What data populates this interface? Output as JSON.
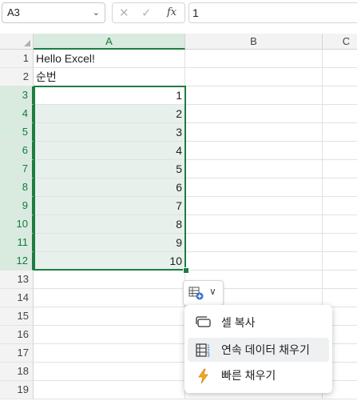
{
  "formula_bar": {
    "name_box": "A3",
    "cancel_glyph": "✕",
    "confirm_glyph": "✓",
    "fx_label": "fx",
    "formula_value": "1"
  },
  "columns": [
    "A",
    "B",
    "C"
  ],
  "selected_column": "A",
  "rows": [
    {
      "num": "1",
      "a": "Hello Excel!",
      "type": "text"
    },
    {
      "num": "2",
      "a": "순번",
      "type": "text"
    },
    {
      "num": "3",
      "a": "1",
      "type": "number"
    },
    {
      "num": "4",
      "a": "2",
      "type": "number"
    },
    {
      "num": "5",
      "a": "3",
      "type": "number"
    },
    {
      "num": "6",
      "a": "4",
      "type": "number"
    },
    {
      "num": "7",
      "a": "5",
      "type": "number"
    },
    {
      "num": "8",
      "a": "6",
      "type": "number"
    },
    {
      "num": "9",
      "a": "7",
      "type": "number"
    },
    {
      "num": "10",
      "a": "8",
      "type": "number"
    },
    {
      "num": "11",
      "a": "9",
      "type": "number"
    },
    {
      "num": "12",
      "a": "10",
      "type": "number"
    },
    {
      "num": "13",
      "a": "",
      "type": "empty"
    },
    {
      "num": "14",
      "a": "",
      "type": "empty"
    },
    {
      "num": "15",
      "a": "",
      "type": "empty"
    },
    {
      "num": "16",
      "a": "",
      "type": "empty"
    },
    {
      "num": "17",
      "a": "",
      "type": "empty"
    },
    {
      "num": "18",
      "a": "",
      "type": "empty"
    },
    {
      "num": "19",
      "a": "",
      "type": "empty"
    }
  ],
  "autofill_menu": {
    "items": [
      {
        "label": "셀 복사",
        "icon": "copy-cells-icon"
      },
      {
        "label": "연속 데이터 채우기",
        "icon": "fill-series-icon"
      },
      {
        "label": "빠른 채우기",
        "icon": "flash-fill-icon"
      }
    ]
  },
  "colors": {
    "accent": "#1d7d43",
    "selection_fill": "#e7f0ea",
    "header_selected": "#d9eadf"
  }
}
